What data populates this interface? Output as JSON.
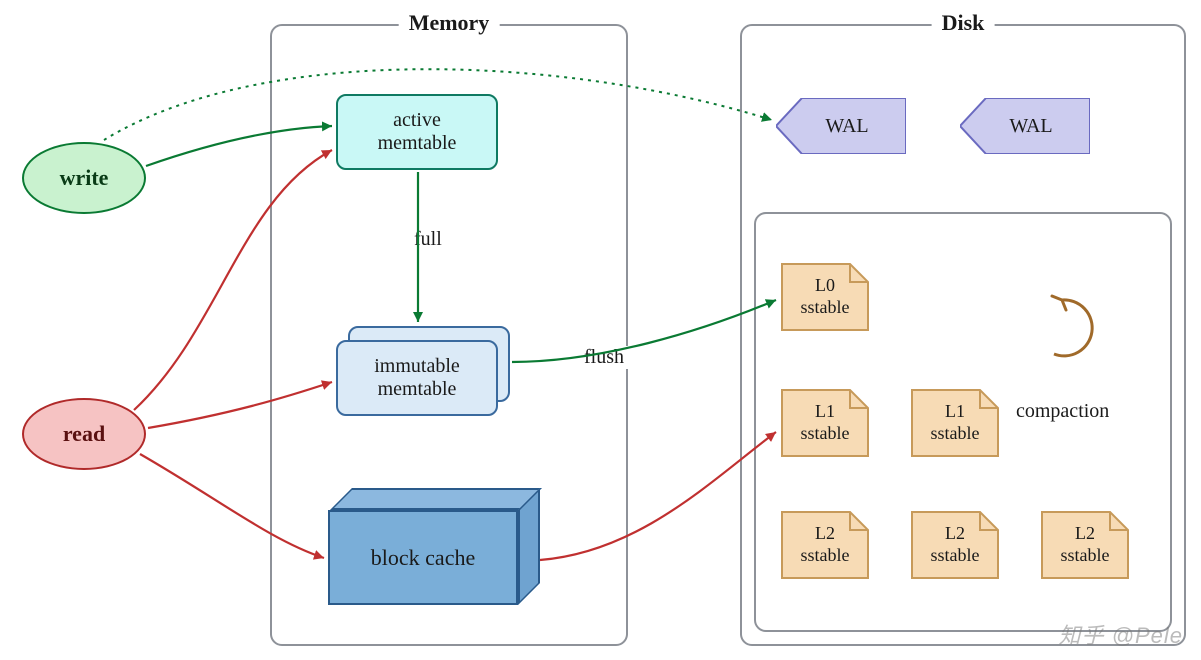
{
  "panels": {
    "memory_title": "Memory",
    "disk_title": "Disk"
  },
  "nodes": {
    "write": "write",
    "read": "read",
    "active_memtable": "active\nmemtable",
    "immutable_memtable": "immutable\nmemtable",
    "block_cache": "block cache",
    "wal1": "WAL",
    "wal2": "WAL"
  },
  "sstables": {
    "l0": "L0\nsstable",
    "l1a": "L1\nsstable",
    "l1b": "L1\nsstable",
    "l2a": "L2\nsstable",
    "l2b": "L2\nsstable",
    "l2c": "L2\nsstable"
  },
  "edge_labels": {
    "full": "full",
    "flush": "flush",
    "compaction": "compaction"
  },
  "colors": {
    "green": "#0a7a33",
    "red": "#c03030",
    "brown": "#a06a2a"
  },
  "watermark": "知乎 @Pele"
}
